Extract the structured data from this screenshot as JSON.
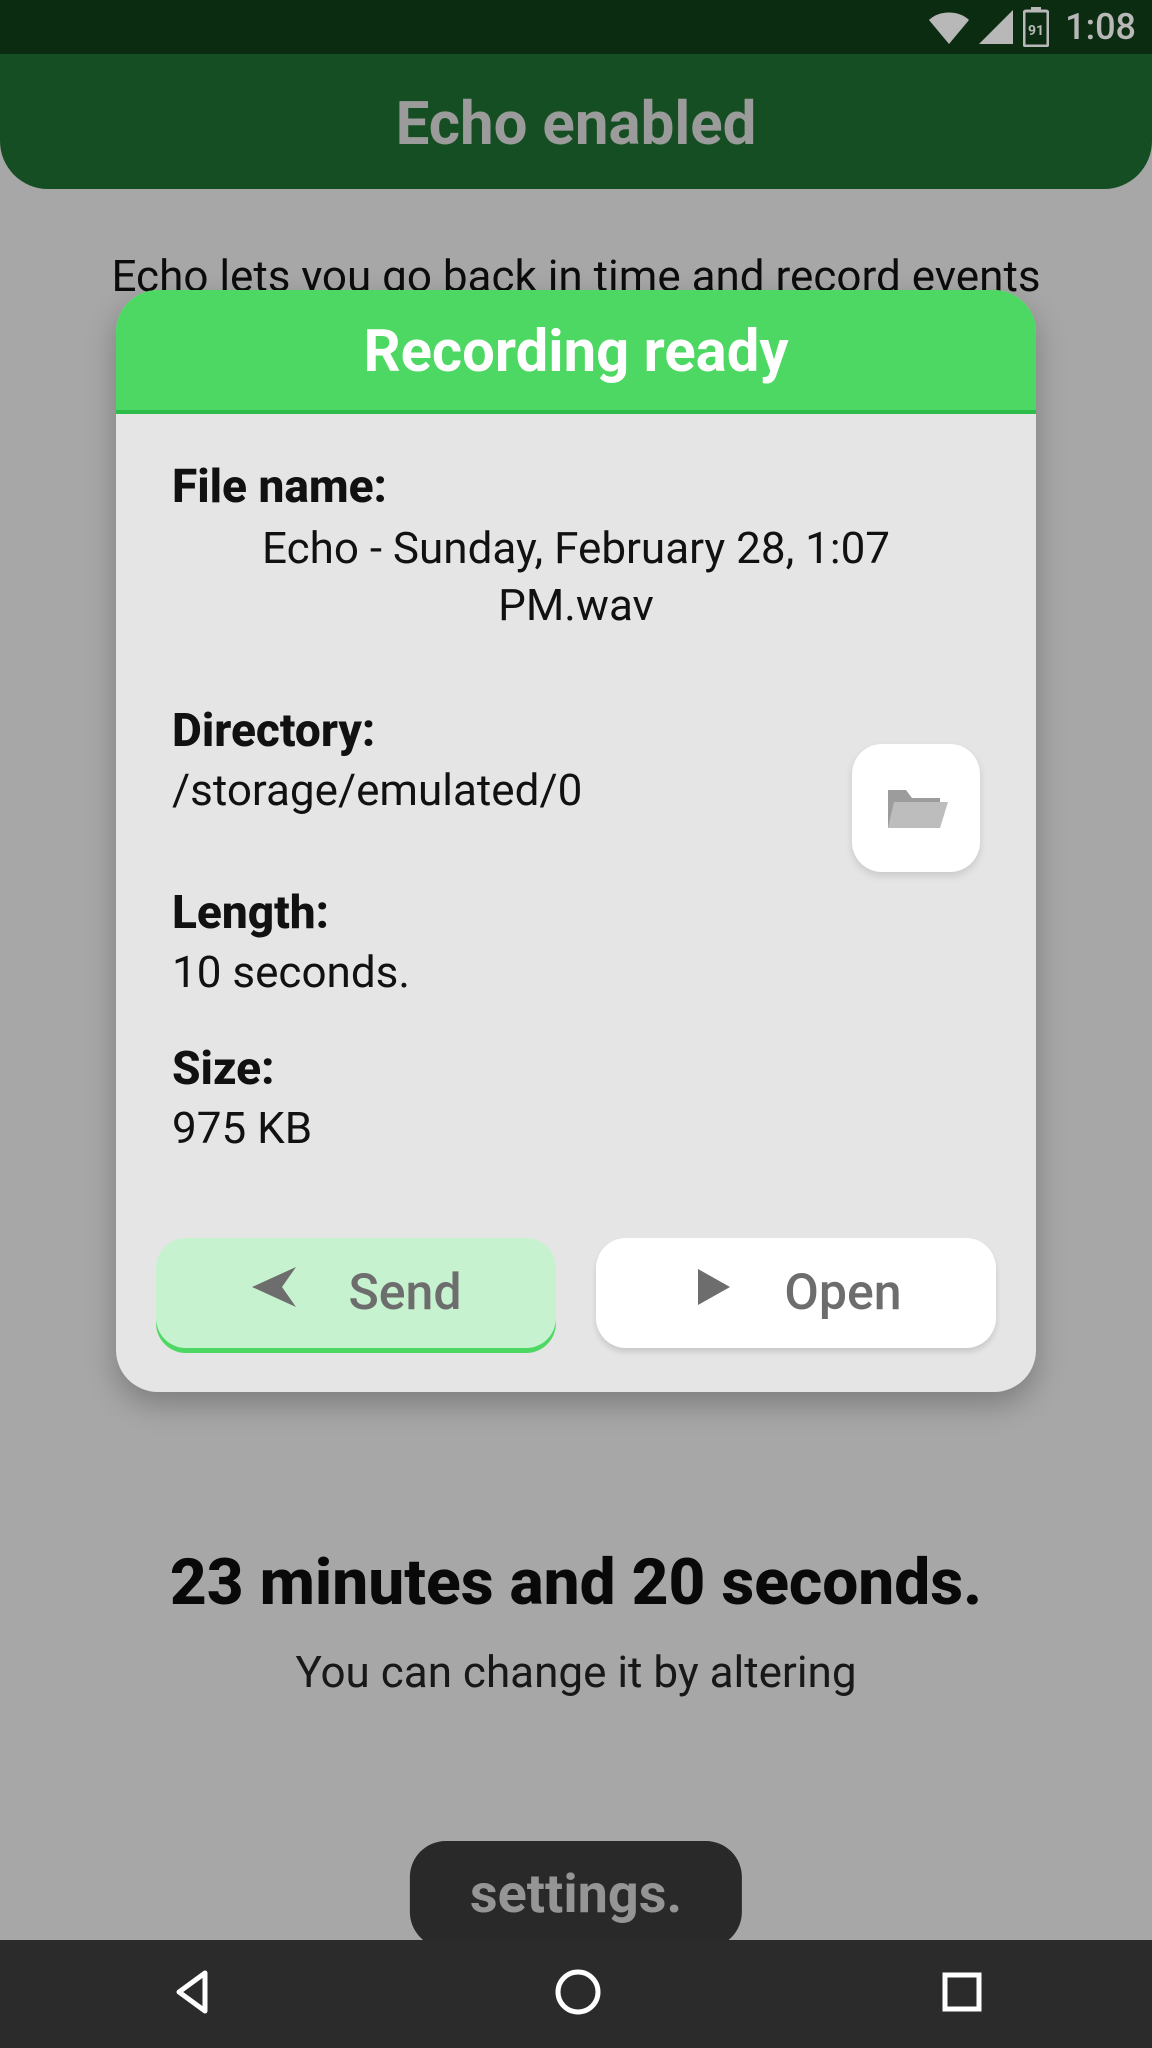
{
  "status": {
    "time": "1:08",
    "battery_level": "91"
  },
  "header": {
    "title": "Echo enabled"
  },
  "main": {
    "subtitle": "Echo lets you go back in time and record events",
    "remaining": "23 minutes and 20 seconds.",
    "change_text": "You can change it by altering",
    "settings_label": "settings."
  },
  "dialog": {
    "title": "Recording ready",
    "filename_label": "File name:",
    "filename_value": "Echo - Sunday, February 28, 1:07 PM.wav",
    "directory_label": "Directory:",
    "directory_value": "/storage/emulated/0",
    "length_label": "Length:",
    "length_value": "10 seconds.",
    "size_label": "Size:",
    "size_value": "975 KB",
    "send_label": "Send",
    "open_label": "Open"
  }
}
